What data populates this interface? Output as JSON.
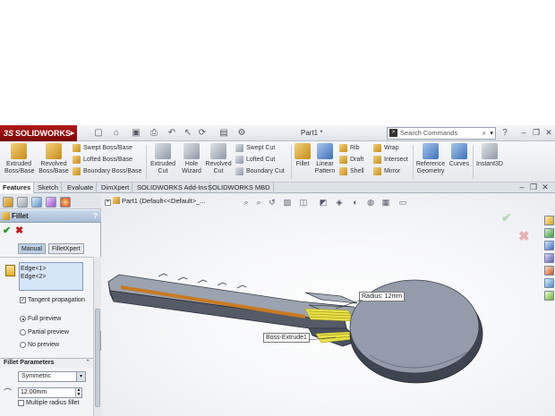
{
  "app": {
    "logo_ds": "3S",
    "logo_text": "SOLIDWORKS",
    "document_title": "Part1 *",
    "search_placeholder": "Search Commands"
  },
  "command_manager": {
    "extruded_boss": "Extruded Boss/Base",
    "revolved_boss": "Revolved Boss/Base",
    "swept_boss": "Swept Boss/Base",
    "lofted_boss": "Lofted Boss/Base",
    "boundary_boss": "Boundary Boss/Base",
    "extruded_cut": "Extruded Cut",
    "hole_wizard": "Hole Wizard",
    "revolved_cut": "Revolved Cut",
    "swept_cut": "Swept Cut",
    "lofted_cut": "Lofted Cut",
    "boundary_cut": "Boundary Cut",
    "fillet": "Fillet",
    "linear_pattern": "Linear Pattern",
    "rib": "Rib",
    "draft": "Draft",
    "shell": "Shell",
    "wrap": "Wrap",
    "intersect": "Intersect",
    "mirror": "Mirror",
    "reference_geometry": "Reference Geometry",
    "curves": "Curves",
    "instant3d": "Instant3D"
  },
  "tabs": [
    "Features",
    "Sketch",
    "Evaluate",
    "DimXpert",
    "SOLIDWORKS Add-Ins",
    "SOLIDWORKS MBD"
  ],
  "active_tab": "Features",
  "property_manager": {
    "title": "Fillet",
    "help": "?",
    "mode_tabs": [
      "Manual",
      "FilletXpert"
    ],
    "active_mode": "Manual",
    "edges": [
      "Edge<1>",
      "Edge<2>"
    ],
    "tangent_propagation": {
      "label": "Tangent propagation",
      "checked": true
    },
    "preview_options": [
      "Full preview",
      "Partial preview",
      "No preview"
    ],
    "selected_preview": "Full preview",
    "fillet_parameters_header": "Fillet Parameters",
    "fillet_type": "Symmetric",
    "radius_value": "12.00mm",
    "multiple_radius": {
      "label": "Multiple radius fillet",
      "checked": false
    }
  },
  "graphics": {
    "tree_item": "Part1  (Default<<Default>_...",
    "radius_callout": "Radius: 12mm",
    "feature_callout": "Boss-Extrude1"
  },
  "colors": {
    "logo_red": "#a01010",
    "ok_green": "#1a9a1a",
    "cancel_red": "#c01a1a",
    "fillet_highlight": "#e8e04a",
    "edge_highlight": "#d07a18"
  }
}
